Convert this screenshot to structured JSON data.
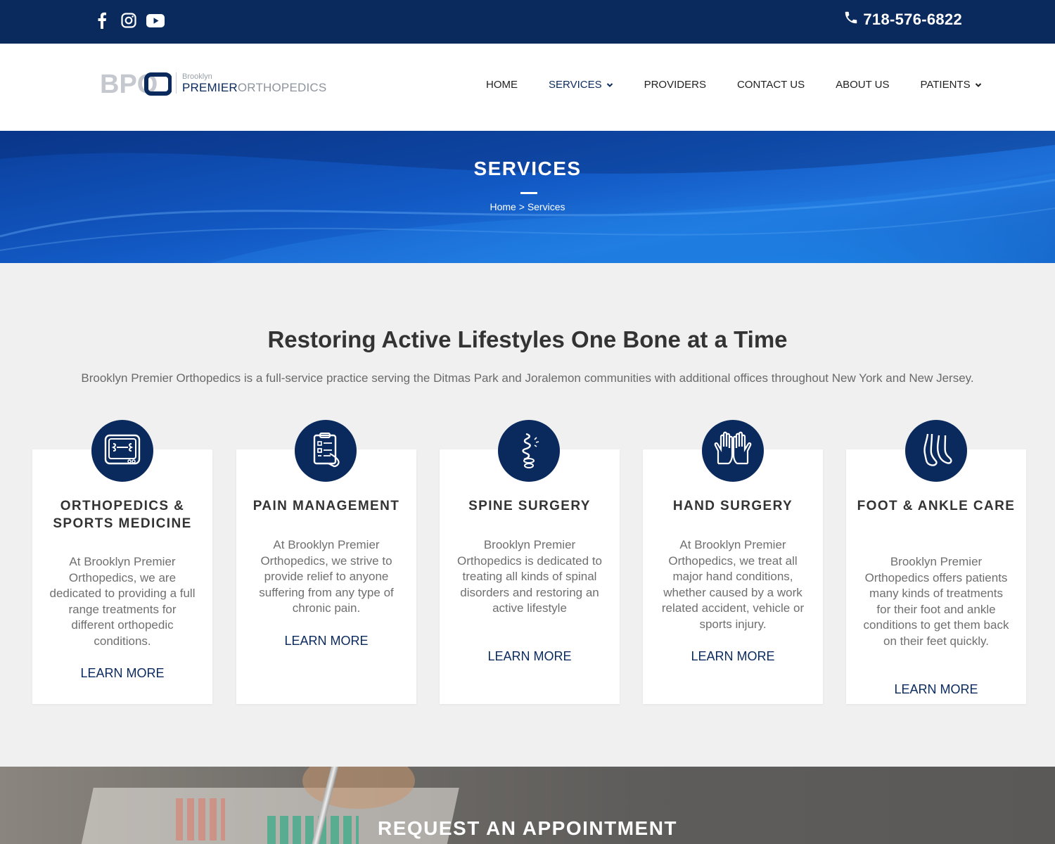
{
  "topbar": {
    "social": [
      "facebook-icon",
      "instagram-icon",
      "youtube-icon"
    ],
    "phone": "718-576-6822"
  },
  "logo": {
    "mark": "BPO",
    "small": "Brooklyn",
    "premier": "PREMIER",
    "orthopedics": "ORTHOPEDICS"
  },
  "nav": {
    "items": [
      {
        "label": "HOME"
      },
      {
        "label": "SERVICES"
      },
      {
        "label": "PROVIDERS"
      },
      {
        "label": "CONTACT US"
      },
      {
        "label": "ABOUT US"
      },
      {
        "label": "PATIENTS"
      }
    ]
  },
  "hero": {
    "title": "SERVICES",
    "breadcrumb_home": "Home",
    "breadcrumb_sep": " > ",
    "breadcrumb_current": "Services"
  },
  "intro": {
    "title": "Restoring Active Lifestyles One Bone at a Time",
    "text": "Brooklyn Premier Orthopedics is a full-service practice serving the Ditmas Park and Joralemon communities with additional offices throughout New York and New Jersey."
  },
  "services": [
    {
      "title": "ORTHOPEDICS & SPORTS MEDICINE",
      "text": "At Brooklyn Premier Orthopedics, we are dedicated to providing a full range treatments for different orthopedic conditions.",
      "link": "LEARN MORE",
      "icon": "xray-icon"
    },
    {
      "title": "PAIN MANAGEMENT",
      "text": "At Brooklyn Premier Orthopedics, we strive to provide relief to anyone suffering from any type of chronic pain.",
      "link": "LEARN MORE",
      "icon": "clipboard-icon"
    },
    {
      "title": "SPINE SURGERY",
      "text": "Brooklyn Premier Orthopedics is dedicated to treating all kinds of spinal disorders and restoring an active lifestyle",
      "link": "LEARN MORE",
      "icon": "spine-icon"
    },
    {
      "title": "HAND SURGERY",
      "text": "At Brooklyn Premier Orthopedics, we treat all major hand conditions, whether caused by a work related accident, vehicle or sports injury.",
      "link": "LEARN MORE",
      "icon": "hands-icon"
    },
    {
      "title": "FOOT & ANKLE CARE",
      "text": "Brooklyn Premier Orthopedics offers patients many kinds of treatments for their foot and ankle conditions to get them back on their feet quickly.",
      "link": "LEARN MORE",
      "icon": "feet-icon"
    }
  ],
  "appointment": {
    "title": "REQUEST AN APPOINTMENT"
  },
  "colors": {
    "navy": "#0a2a5e",
    "hero_blue": "#1259c4",
    "background": "#f0f0f0"
  }
}
